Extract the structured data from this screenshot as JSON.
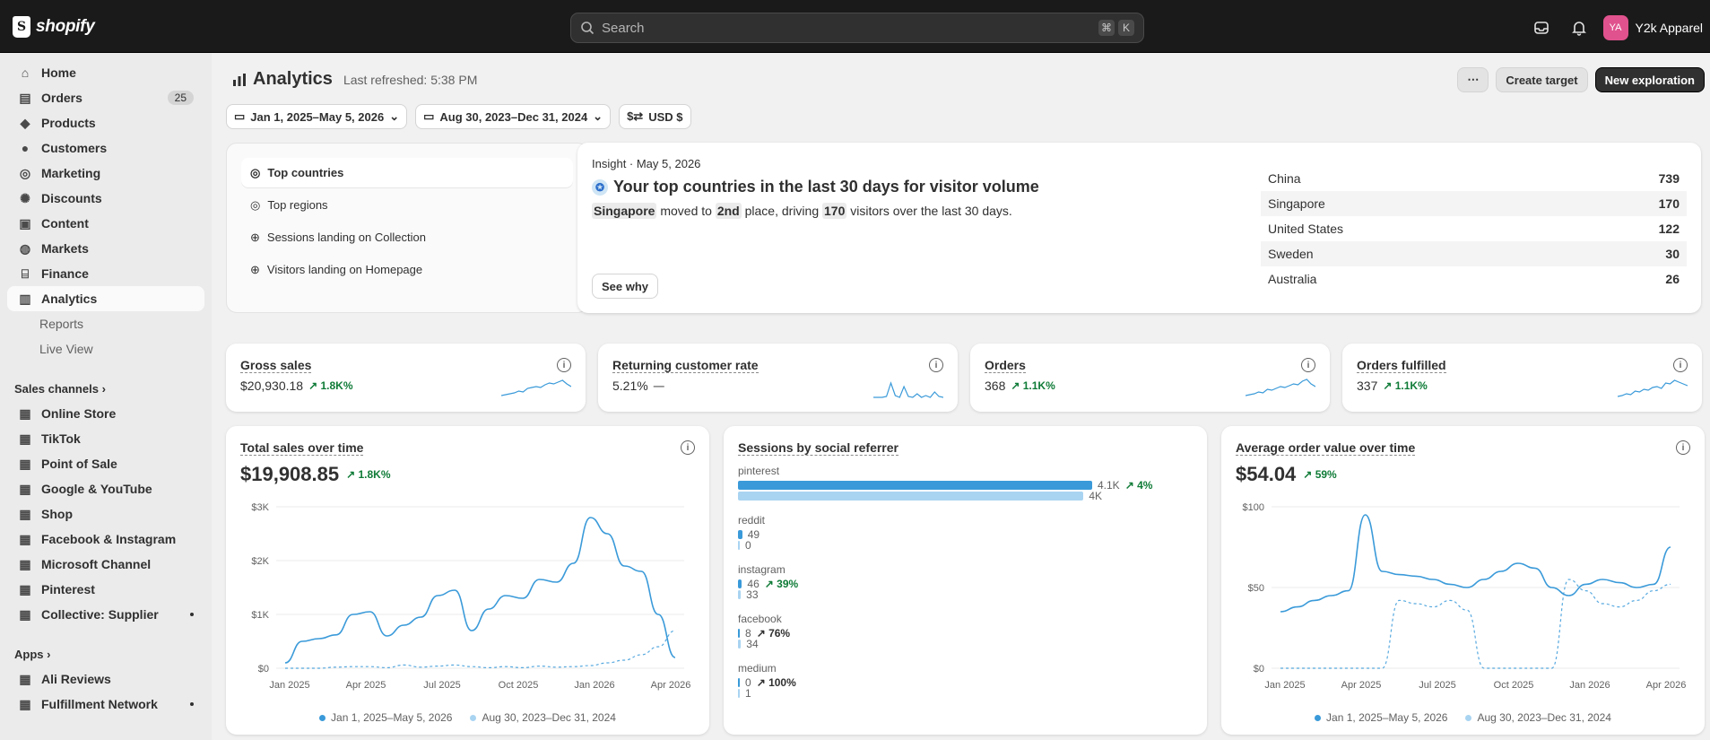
{
  "topbar": {
    "brand": "shopify",
    "search_placeholder": "Search",
    "kbd1": "⌘",
    "kbd2": "K",
    "store_initials": "YA",
    "store_name": "Y2k Apparel"
  },
  "sidebar": {
    "items": [
      {
        "label": "Home",
        "icon": "home-icon"
      },
      {
        "label": "Orders",
        "icon": "orders-icon",
        "badge": "25"
      },
      {
        "label": "Products",
        "icon": "tag-icon"
      },
      {
        "label": "Customers",
        "icon": "person-icon"
      },
      {
        "label": "Marketing",
        "icon": "target-icon"
      },
      {
        "label": "Discounts",
        "icon": "discount-icon"
      },
      {
        "label": "Content",
        "icon": "content-icon"
      },
      {
        "label": "Markets",
        "icon": "globe-icon"
      },
      {
        "label": "Finance",
        "icon": "bank-icon"
      },
      {
        "label": "Analytics",
        "icon": "chart-icon"
      }
    ],
    "subitems": [
      "Reports",
      "Live View"
    ],
    "sales_channels_label": "Sales channels",
    "channels": [
      "Online Store",
      "TikTok",
      "Point of Sale",
      "Google & YouTube",
      "Shop",
      "Facebook & Instagram",
      "Microsoft Channel",
      "Pinterest",
      "Collective: Supplier"
    ],
    "apps_label": "Apps",
    "apps": [
      "Ali Reviews",
      "Fulfillment Network"
    ]
  },
  "header": {
    "title": "Analytics",
    "refreshed": "Last refreshed: 5:38 PM",
    "create_target": "Create target",
    "new_exploration": "New exploration"
  },
  "filters": {
    "date_range": "Jan 1, 2025–May 5, 2026",
    "compare_range": "Aug 30, 2023–Dec 31, 2024",
    "currency": "USD $"
  },
  "insight_list": [
    "Top countries",
    "Top regions",
    "Sessions landing on Collection",
    "Visitors landing on Homepage"
  ],
  "insight": {
    "meta": "Insight · May 5, 2026",
    "title": "Your top countries in the last 30 days for visitor volume",
    "country": "Singapore",
    "moved": "moved to",
    "rank": "2nd",
    "place_text": "place, driving",
    "visitors": "170",
    "tail": "visitors over the last 30 days.",
    "see_why": "See why",
    "countries": [
      [
        "China",
        "739"
      ],
      [
        "Singapore",
        "170"
      ],
      [
        "United States",
        "122"
      ],
      [
        "Sweden",
        "30"
      ],
      [
        "Australia",
        "26"
      ]
    ]
  },
  "kpis": [
    {
      "label": "Gross sales",
      "value": "$20,930.18",
      "delta": "1.8K%"
    },
    {
      "label": "Returning customer rate",
      "value": "5.21%",
      "delta": "—"
    },
    {
      "label": "Orders",
      "value": "368",
      "delta": "1.1K%"
    },
    {
      "label": "Orders fulfilled",
      "value": "337",
      "delta": "1.1K%"
    }
  ],
  "cards": {
    "sales": {
      "title": "Total sales over time",
      "value": "$19,908.85",
      "delta": "1.8K%"
    },
    "social": {
      "title": "Sessions by social referrer"
    },
    "aov": {
      "title": "Average order value over time",
      "value": "$54.04",
      "delta": "59%"
    }
  },
  "legend": {
    "current": "Jan 1, 2025–May 5, 2026",
    "previous": "Aug 30, 2023–Dec 31, 2024"
  },
  "colors": {
    "current": "#3a9ad9",
    "previous": "#a9d4f1",
    "positive": "#0f7b37"
  },
  "chart_data": [
    {
      "type": "line",
      "title": "Total sales over time",
      "x": [
        "Jan 2025",
        "Apr 2025",
        "Jul 2025",
        "Oct 2025",
        "Jan 2026",
        "Apr 2026"
      ],
      "ylim": [
        0,
        3000
      ],
      "yticks": [
        "$0",
        "$1K",
        "$2K",
        "$3K"
      ],
      "series": [
        {
          "name": "Jan 1, 2025–May 5, 2026",
          "values": [
            100,
            500,
            550,
            620,
            1000,
            1050,
            600,
            800,
            950,
            1350,
            1450,
            700,
            1100,
            1350,
            1300,
            1650,
            1600,
            1950,
            2800,
            2500,
            1900,
            1800,
            1000,
            200
          ]
        },
        {
          "name": "Aug 30, 2023–Dec 31, 2024",
          "values": [
            0,
            0,
            0,
            20,
            30,
            30,
            10,
            60,
            20,
            40,
            60,
            30,
            10,
            30,
            10,
            40,
            20,
            30,
            50,
            100,
            150,
            250,
            400,
            700
          ]
        }
      ]
    },
    {
      "type": "bar",
      "title": "Sessions by social referrer",
      "categories": [
        "pinterest",
        "reddit",
        "instagram",
        "facebook",
        "medium"
      ],
      "series": [
        {
          "name": "Jan 1, 2025–May 5, 2026",
          "values": [
            4100,
            49,
            46,
            8,
            0
          ],
          "labels": [
            "4.1K",
            "49",
            "46",
            "8",
            "0"
          ]
        },
        {
          "name": "Aug 30, 2023–Dec 31, 2024",
          "values": [
            4000,
            0,
            33,
            34,
            1
          ],
          "labels": [
            "4K",
            "0",
            "33",
            "34",
            "1"
          ]
        }
      ],
      "deltas": [
        "4%",
        "",
        "39%",
        "76%",
        "100%"
      ]
    },
    {
      "type": "line",
      "title": "Average order value over time",
      "x": [
        "Jan 2025",
        "Apr 2025",
        "Jul 2025",
        "Oct 2025",
        "Jan 2026",
        "Apr 2026"
      ],
      "ylim": [
        0,
        100
      ],
      "yticks": [
        "$0",
        "$50",
        "$100"
      ],
      "series": [
        {
          "name": "Jan 1, 2025–May 5, 2026",
          "values": [
            35,
            38,
            42,
            45,
            48,
            95,
            60,
            58,
            57,
            55,
            52,
            50,
            55,
            60,
            65,
            62,
            50,
            45,
            52,
            55,
            53,
            50,
            52,
            75
          ]
        },
        {
          "name": "Aug 30, 2023–Dec 31, 2024",
          "values": [
            0,
            0,
            0,
            0,
            0,
            0,
            0,
            42,
            40,
            38,
            42,
            36,
            0,
            0,
            0,
            0,
            0,
            55,
            48,
            40,
            38,
            42,
            48,
            52
          ]
        }
      ]
    }
  ]
}
